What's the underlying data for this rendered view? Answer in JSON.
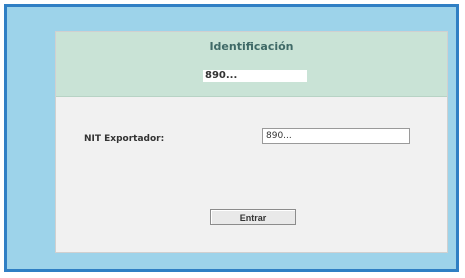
{
  "colors": {
    "frame_border": "#2f7fc4",
    "frame_background": "#9dd3ea",
    "panel_background": "#f1f1f1",
    "header_background": "#c9e3d6",
    "header_text": "#3f6a67"
  },
  "header": {
    "title": "Identificación",
    "value": "890..."
  },
  "form": {
    "nit_label": "NIT Exportador:",
    "nit_value": "890..."
  },
  "actions": {
    "submit_label": "Entrar"
  }
}
